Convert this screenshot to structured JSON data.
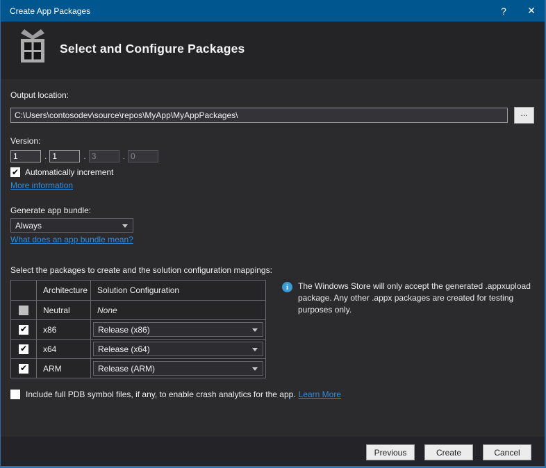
{
  "window": {
    "title": "Create App Packages",
    "help_glyph": "?",
    "close_glyph": "✕"
  },
  "header": {
    "title": "Select and Configure Packages"
  },
  "output": {
    "label": "Output location:",
    "value": "C:\\Users\\contosodev\\source\\repos\\MyApp\\MyAppPackages\\",
    "browse_label": "..."
  },
  "version": {
    "label": "Version:",
    "separator": ".",
    "fields": [
      {
        "value": "1",
        "enabled": true
      },
      {
        "value": "1",
        "enabled": true
      },
      {
        "value": "3",
        "enabled": false
      },
      {
        "value": "0",
        "enabled": false
      }
    ],
    "auto_increment_label": "Automatically increment",
    "auto_increment_checked": true,
    "more_info_link": "More information"
  },
  "bundle": {
    "label": "Generate app bundle:",
    "selected": "Always",
    "link": "What does an app bundle mean?"
  },
  "packages": {
    "label": "Select the packages to create and the solution configuration mappings:",
    "columns": [
      "",
      "Architecture",
      "Solution Configuration"
    ],
    "rows": [
      {
        "checked": false,
        "disabled": true,
        "architecture": "Neutral",
        "configuration": "None",
        "is_dropdown": false
      },
      {
        "checked": true,
        "disabled": false,
        "architecture": "x86",
        "configuration": "Release (x86)",
        "is_dropdown": true
      },
      {
        "checked": true,
        "disabled": false,
        "architecture": "x64",
        "configuration": "Release (x64)",
        "is_dropdown": true
      },
      {
        "checked": true,
        "disabled": false,
        "architecture": "ARM",
        "configuration": "Release (ARM)",
        "is_dropdown": true
      }
    ]
  },
  "info_note": {
    "text": "The Windows Store will only accept the generated .appxupload package. Any other .appx packages are created for testing purposes only."
  },
  "pdb": {
    "checked": false,
    "label": "Include full PDB symbol files, if any, to enable crash analytics for the app.",
    "link": "Learn More"
  },
  "footer": {
    "buttons": [
      "Previous",
      "Create",
      "Cancel"
    ]
  },
  "colors": {
    "titlebar": "#00568f",
    "link": "#2e8de0",
    "info_icon": "#3a9cd6",
    "content_bg": "#2b2b2e",
    "header_bg": "#242427"
  }
}
